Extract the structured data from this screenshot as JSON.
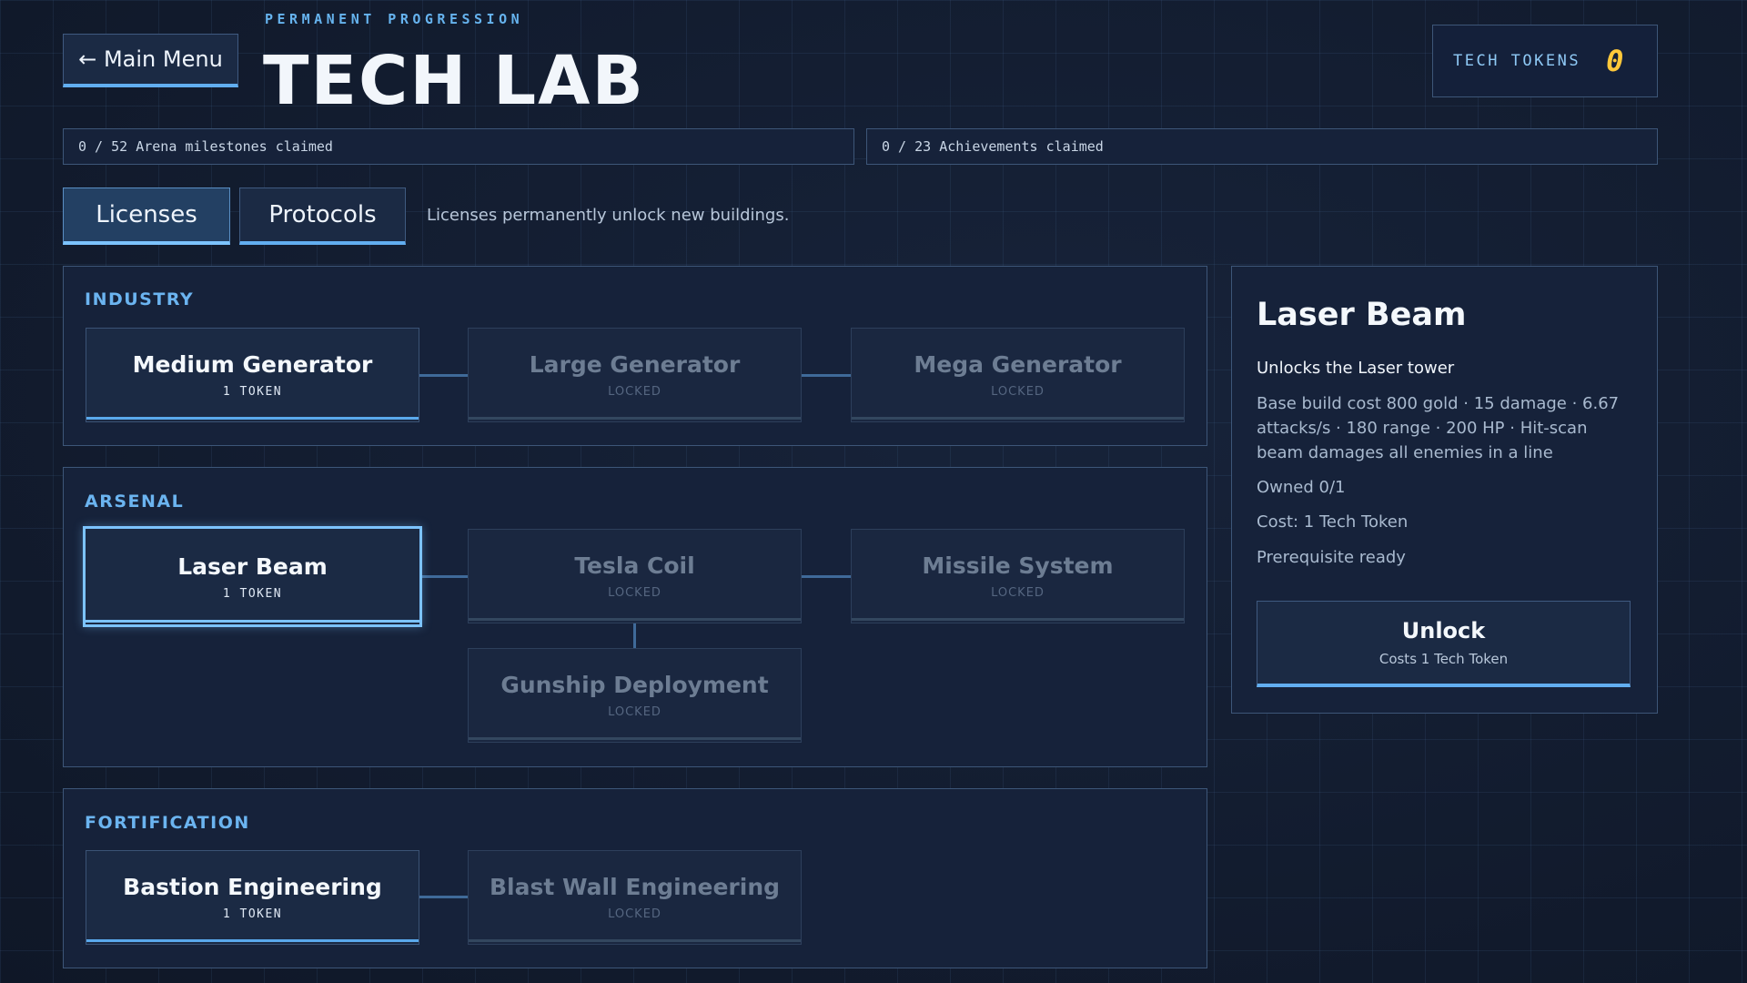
{
  "header": {
    "back_label": "← Main Menu",
    "eyebrow": "PERMANENT PROGRESSION",
    "title": "TECH LAB",
    "tokens_label": "TECH TOKENS",
    "tokens_value": "0"
  },
  "progress": {
    "milestones": "0 / 52 Arena milestones claimed",
    "achievements": "0 / 23 Achievements claimed"
  },
  "tabs": [
    {
      "label": "Licenses",
      "active": true
    },
    {
      "label": "Protocols",
      "active": false
    }
  ],
  "tab_hint": "Licenses permanently unlock new buildings.",
  "sections": {
    "industry": {
      "title": "INDUSTRY",
      "nodes": [
        {
          "name": "Medium Generator",
          "status": "1 TOKEN"
        },
        {
          "name": "Large Generator",
          "status": "LOCKED"
        },
        {
          "name": "Mega Generator",
          "status": "LOCKED"
        }
      ]
    },
    "arsenal": {
      "title": "ARSENAL",
      "nodes": [
        {
          "name": "Laser Beam",
          "status": "1 TOKEN"
        },
        {
          "name": "Tesla Coil",
          "status": "LOCKED"
        },
        {
          "name": "Missile System",
          "status": "LOCKED"
        },
        {
          "name": "Gunship Deployment",
          "status": "LOCKED"
        }
      ]
    },
    "fortification": {
      "title": "FORTIFICATION",
      "nodes": [
        {
          "name": "Bastion Engineering",
          "status": "1 TOKEN"
        },
        {
          "name": "Blast Wall Engineering",
          "status": "LOCKED"
        }
      ]
    }
  },
  "detail": {
    "title": "Laser Beam",
    "subtitle": "Unlocks the Laser tower",
    "description": "Base build cost 800 gold · 15 damage · 6.67 attacks/s · 180 range · 200 HP · Hit-scan beam damages all enemies in a line",
    "owned": "Owned 0/1",
    "cost": "Cost: 1 Tech Token",
    "prereq": "Prerequisite ready",
    "unlock_label": "Unlock",
    "unlock_sub": "Costs 1 Tech Token"
  },
  "colors": {
    "accent": "#62aef0",
    "token": "#ffc83a",
    "background": "#111a2b"
  }
}
